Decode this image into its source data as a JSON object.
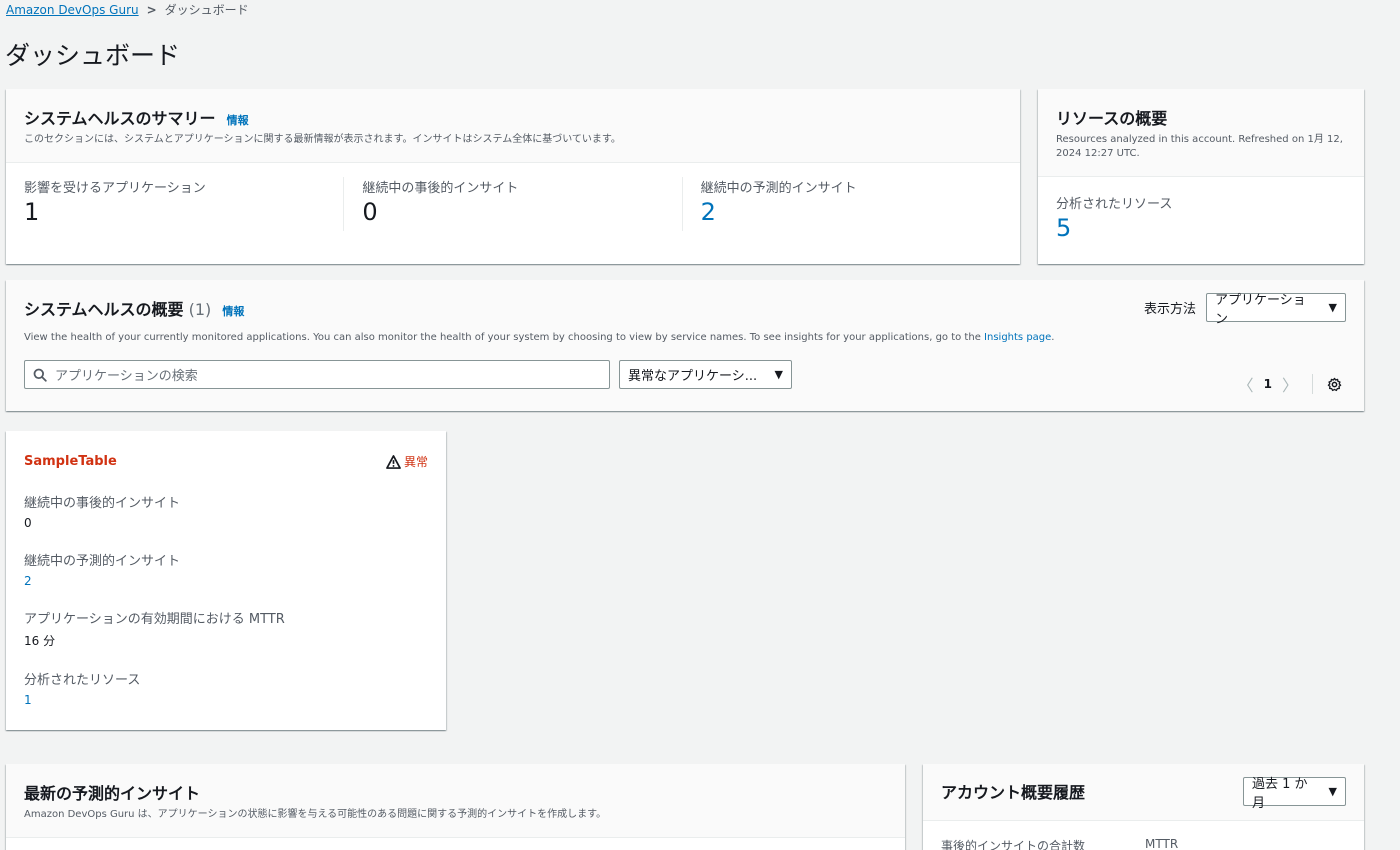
{
  "breadcrumb": {
    "root": "Amazon DevOps Guru",
    "separator": ">",
    "current": "ダッシュボード"
  },
  "page_title": "ダッシュボード",
  "summary": {
    "title": "システムヘルスのサマリー",
    "info": "情報",
    "description": "このセクションには、システムとアプリケーションに関する最新情報が表示されます。インサイトはシステム全体に基づいています。",
    "metrics": [
      {
        "label": "影響を受けるアプリケーション",
        "value": "1"
      },
      {
        "label": "継続中の事後的インサイト",
        "value": "0"
      },
      {
        "label": "継続中の予測的インサイト",
        "value": "2"
      }
    ]
  },
  "resources": {
    "title": "リソースの概要",
    "description": "Resources analyzed in this account. Refreshed on 1月 12, 2024 12:27 UTC.",
    "label": "分析されたリソース",
    "value": "5"
  },
  "health": {
    "title": "システムヘルスの概要",
    "count": "(1)",
    "info": "情報",
    "description": "View the health of your currently monitored applications. You can also monitor the health of your system by choosing to view by service names. To see insights for your applications, go to the",
    "insights_link": "Insights page",
    "period": ".",
    "display_label": "表示方法",
    "display_value": "アプリケーション",
    "search_placeholder": "アプリケーションの検索",
    "filter_value": "異常なアプリケーシ...",
    "page": "1"
  },
  "app_card": {
    "name": "SampleTable",
    "status": "異常",
    "fields": [
      {
        "label": "継続中の事後的インサイト",
        "value": "0"
      },
      {
        "label": "継続中の予測的インサイト",
        "value": "2"
      },
      {
        "label": "アプリケーションの有効期間における MTTR",
        "value": "16 分"
      },
      {
        "label": "分析されたリソース",
        "value": "1"
      }
    ]
  },
  "predictive": {
    "title": "最新の予測的インサイト",
    "description": "Amazon DevOps Guru は、アプリケーションの状態に影響を与える可能性のある問題に関する予測的インサイトを作成します。"
  },
  "history": {
    "title": "アカウント概要履歴",
    "period_value": "過去 1 か月",
    "col1": "事後的インサイトの合計数",
    "col2": "MTTR"
  },
  "colors": {
    "link": "#0073bb",
    "alert": "#d13212",
    "background": "#f2f3f3"
  }
}
